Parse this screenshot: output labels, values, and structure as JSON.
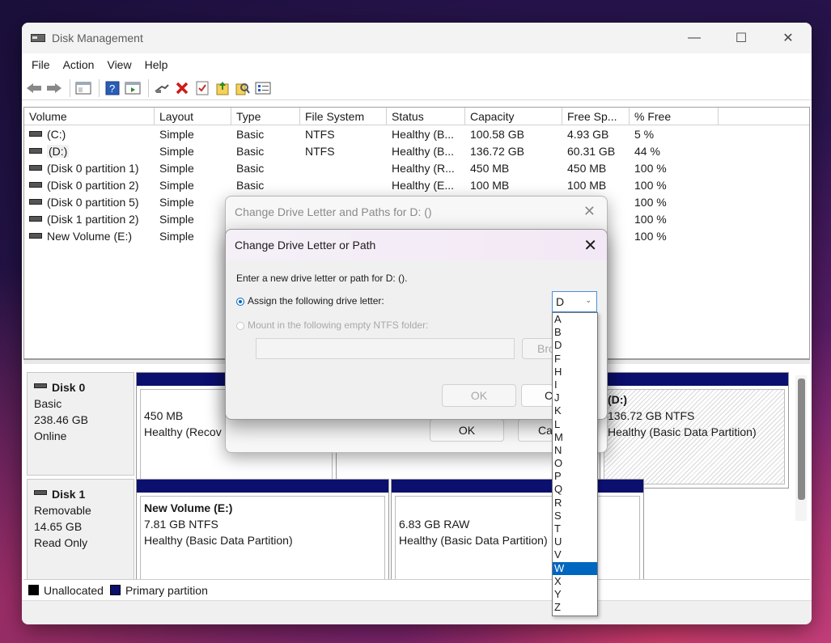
{
  "window": {
    "title": "Disk Management",
    "minimize": "—",
    "maximize": "☐",
    "close": "✕"
  },
  "menu": [
    "File",
    "Action",
    "View",
    "Help"
  ],
  "columns": [
    "Volume",
    "Layout",
    "Type",
    "File System",
    "Status",
    "Capacity",
    "Free Sp...",
    "% Free"
  ],
  "volumes": [
    {
      "volume": "(C:)",
      "layout": "Simple",
      "type": "Basic",
      "fs": "NTFS",
      "status": "Healthy (B...",
      "capacity": "100.58 GB",
      "free": "4.93 GB",
      "pct": "5 %"
    },
    {
      "volume": "(D:)",
      "layout": "Simple",
      "type": "Basic",
      "fs": "NTFS",
      "status": "Healthy (B...",
      "capacity": "136.72 GB",
      "free": "60.31 GB",
      "pct": "44 %"
    },
    {
      "volume": "(Disk 0 partition 1)",
      "layout": "Simple",
      "type": "Basic",
      "fs": "",
      "status": "Healthy (R...",
      "capacity": "450 MB",
      "free": "450 MB",
      "pct": "100 %"
    },
    {
      "volume": "(Disk 0 partition 2)",
      "layout": "Simple",
      "type": "Basic",
      "fs": "",
      "status": "Healthy (E...",
      "capacity": "100 MB",
      "free": "100 MB",
      "pct": "100 %"
    },
    {
      "volume": "(Disk 0 partition 5)",
      "layout": "Simple",
      "type": "",
      "fs": "",
      "status": "",
      "capacity": "",
      "free": "",
      "pct": "100 %"
    },
    {
      "volume": "(Disk 1 partition 2)",
      "layout": "Simple",
      "type": "",
      "fs": "",
      "status": "",
      "capacity": "",
      "free": "",
      "pct": "100 %"
    },
    {
      "volume": "New Volume (E:)",
      "layout": "Simple",
      "type": "",
      "fs": "",
      "status": "",
      "capacity": "",
      "free": "",
      "pct": "100 %"
    }
  ],
  "disks": {
    "disk0": {
      "name": "Disk 0",
      "type": "Basic",
      "size": "238.46 GB",
      "state": "Online",
      "p1": {
        "size": "450 MB",
        "status": "Healthy (Recov"
      },
      "pd": {
        "name": "(D:)",
        "size": "136.72 GB NTFS",
        "status": "Healthy (Basic Data Partition)"
      }
    },
    "disk1": {
      "name": "Disk 1",
      "type": "Removable",
      "size": "14.65 GB",
      "state": "Read Only",
      "p1": {
        "name": "New Volume  (E:)",
        "size": "7.81 GB NTFS",
        "status": "Healthy (Basic Data Partition)"
      },
      "p2": {
        "size": "6.83 GB RAW",
        "status": "Healthy (Basic Data Partition)"
      }
    }
  },
  "legend": {
    "unallocated": "Unallocated",
    "primary": "Primary partition",
    "unallocated_color": "#000000",
    "primary_color": "#0b0f6e"
  },
  "dialog_back": {
    "title": "Change Drive Letter and Paths for D: ()",
    "ok": "OK",
    "cancel": "Ca"
  },
  "dialog_front": {
    "title": "Change Drive Letter or Path",
    "prompt": "Enter a new drive letter or path for D: ().",
    "assign_label": "Assign the following drive letter:",
    "mount_label": "Mount in the following empty NTFS folder:",
    "browse": "Bro",
    "ok": "OK",
    "cancel": "C",
    "selected_letter": "D"
  },
  "letters": [
    "A",
    "B",
    "D",
    "F",
    "H",
    "I",
    "J",
    "K",
    "L",
    "M",
    "N",
    "O",
    "P",
    "Q",
    "R",
    "S",
    "T",
    "U",
    "V",
    "W",
    "X",
    "Y",
    "Z"
  ],
  "highlighted_letter": "W",
  "accent_color": "#0067c0"
}
